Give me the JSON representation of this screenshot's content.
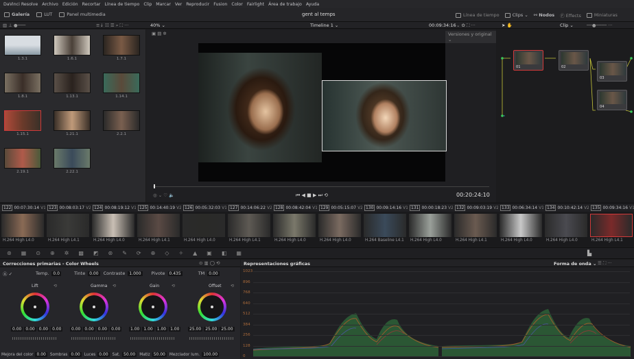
{
  "menubar": {
    "items": [
      "DaVinci Resolve",
      "Archivo",
      "Edición",
      "Recortar",
      "Línea de tiempo",
      "Clip",
      "Marcar",
      "Ver",
      "Reproducir",
      "Fusion",
      "Color",
      "Fairlight",
      "Área de trabajo",
      "Ayuda"
    ]
  },
  "toolbar": {
    "gallery": "Galería",
    "lut": "LUT",
    "media_pool": "Panel multimedia",
    "project_title": "gent al temps",
    "timeline_btn": "Línea de tiempo",
    "clips_btn": "Clips",
    "nodes_btn": "Nodos",
    "effects_btn": "Effects",
    "thumbnails_btn": "Miniaturas"
  },
  "subbar": {
    "zoom": "40%",
    "timeline_name": "Timeline 1",
    "timecode": "00:09:34:16",
    "clip_mode": "Clip"
  },
  "viewer": {
    "versions": "Versiones y original",
    "timecode": "00:20:24:10"
  },
  "gallery": {
    "stills": [
      "1.3.1",
      "1.6.1",
      "1.7.1",
      "1.8.1",
      "1.13.1",
      "1.14.1",
      "1.15.1",
      "1.21.1",
      "2.2.1",
      "2.19.1",
      "2.22.1"
    ]
  },
  "nodes": {
    "labels": [
      "01",
      "02",
      "03",
      "04"
    ]
  },
  "clips": [
    {
      "num": "122",
      "tc": "00:07:30:14",
      "track": "V1",
      "codec": "H.264 High L4.0"
    },
    {
      "num": "123",
      "tc": "00:08:03:17",
      "track": "V2",
      "codec": "H.264 High L4.1"
    },
    {
      "num": "124",
      "tc": "00:08:19:12",
      "track": "V1",
      "codec": "H.264 High L4.0"
    },
    {
      "num": "125",
      "tc": "00:14:40:19",
      "track": "V2",
      "codec": "H.264 High L4.1"
    },
    {
      "num": "126",
      "tc": "00:05:32:03",
      "track": "V1",
      "codec": "H.264 High L4.0"
    },
    {
      "num": "127",
      "tc": "00:14:06:22",
      "track": "V2",
      "codec": "H.264 High L4.1"
    },
    {
      "num": "128",
      "tc": "00:08:42:04",
      "track": "V1",
      "codec": "H.264 High L4.0"
    },
    {
      "num": "129",
      "tc": "00:05:15:07",
      "track": "V2",
      "codec": "H.264 High L4.0"
    },
    {
      "num": "130",
      "tc": "00:09:14:16",
      "track": "V1",
      "codec": "H.264 Baseline L4.1"
    },
    {
      "num": "131",
      "tc": "00:00:18:23",
      "track": "V2",
      "codec": "H.264 High L4.0"
    },
    {
      "num": "132",
      "tc": "00:09:03:19",
      "track": "V2",
      "codec": "H.264 High L4.1"
    },
    {
      "num": "133",
      "tc": "00:06:34:14",
      "track": "V1",
      "codec": "H.264 High L4.0"
    },
    {
      "num": "134",
      "tc": "00:10:42:14",
      "track": "V2",
      "codec": "H.264 High L4.0"
    },
    {
      "num": "135",
      "tc": "00:09:34:16",
      "track": "V1",
      "codec": "H.264 High L4.1"
    }
  ],
  "color_wheels": {
    "title": "Correcciones primarias - Color Wheels",
    "temp_label": "Temp.",
    "temp": "0.0",
    "tint_label": "Tinte",
    "tint": "0.00",
    "contrast_label": "Contraste",
    "contrast": "1.000",
    "pivot_label": "Pivote",
    "pivot": "0.435",
    "tm_label": "TM",
    "tm": "0.00",
    "wheels": [
      {
        "name": "Lift",
        "values": [
          "0.00",
          "0.00",
          "0.00",
          "0.00"
        ]
      },
      {
        "name": "Gamma",
        "values": [
          "0.00",
          "0.00",
          "0.00",
          "0.00"
        ]
      },
      {
        "name": "Gain",
        "values": [
          "1.00",
          "1.00",
          "1.00",
          "1.00"
        ]
      },
      {
        "name": "Offset",
        "values": [
          "25.00",
          "25.00",
          "25.00"
        ]
      }
    ],
    "bottom": {
      "color_boost_label": "Mejora del color",
      "color_boost": "0.00",
      "shadows_label": "Sombras",
      "shadows": "0.00",
      "lights_label": "Luces",
      "lights": "0.00",
      "sat_label": "Sat.",
      "sat": "50.00",
      "hue_label": "Matiz",
      "hue": "50.00",
      "lum_mix_label": "Mezclador lum.",
      "lum_mix": "100.00"
    }
  },
  "scope": {
    "title": "Representaciones gráficas",
    "mode": "Forma de onda",
    "ticks": [
      "1023",
      "896",
      "768",
      "640",
      "512",
      "384",
      "256",
      "128",
      "0"
    ]
  },
  "colors": {
    "accent": "#d23a3a",
    "waveform_green": "#3fbf5f",
    "waveform_orange": "#c07030"
  }
}
